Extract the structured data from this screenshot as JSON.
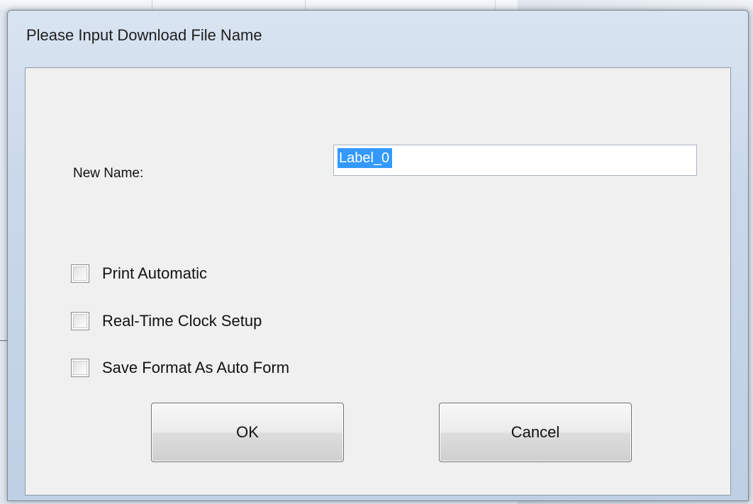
{
  "dialog": {
    "title": "Please Input Download File Name",
    "new_name_label": "New Name:",
    "new_name_value": "Label_0",
    "options": [
      {
        "label": "Print Automatic",
        "checked": false
      },
      {
        "label": "Real-Time Clock Setup",
        "checked": false
      },
      {
        "label": "Save Format As Auto Form",
        "checked": false
      }
    ],
    "ok_label": "OK",
    "cancel_label": "Cancel"
  }
}
